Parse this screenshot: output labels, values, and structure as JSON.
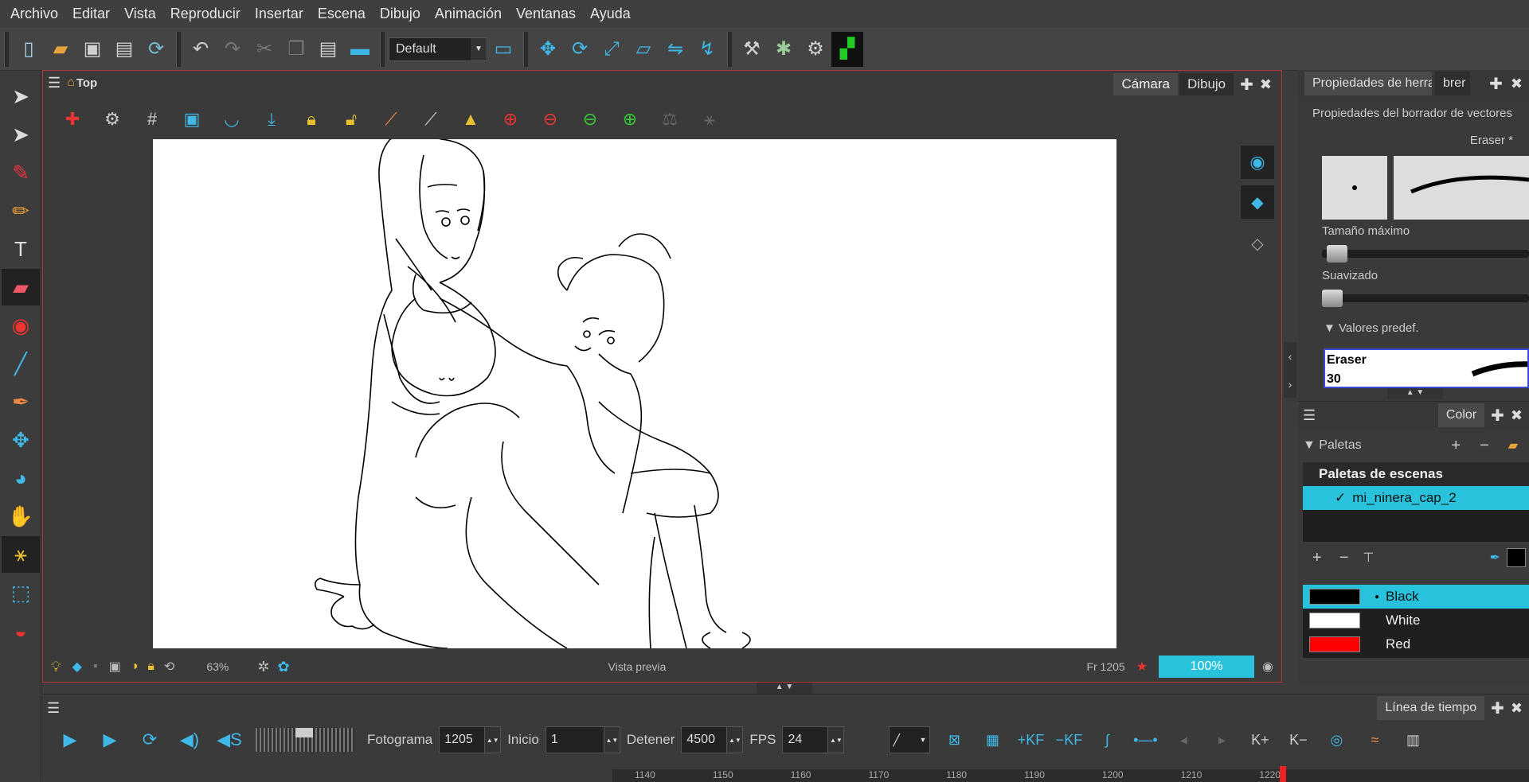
{
  "menu": [
    "Archivo",
    "Editar",
    "Vista",
    "Reproducir",
    "Insertar",
    "Escena",
    "Dibujo",
    "Animación",
    "Ventanas",
    "Ayuda"
  ],
  "toolbar": {
    "workspace": "Default"
  },
  "view": {
    "breadcrumb": "Top",
    "tabs": [
      "Cámara",
      "Dibujo"
    ],
    "zoom": "63%",
    "preview_label": "Vista previa",
    "frame": "Fr 1205",
    "percent": "100%",
    "colors": {
      "accent": "#29c2dc",
      "frame_border": "#b53535"
    }
  },
  "tool_properties": {
    "tabs": [
      "Propiedades de herra..",
      "brer"
    ],
    "heading": "Propiedades del borrador de vectores",
    "preset_name": "Eraser *",
    "max_size_label": "Tamaño máximo",
    "smoothing_label": "Suavizado",
    "presets_label": "Valores predef.",
    "preset_card_title": "Eraser",
    "preset_card_size": "30"
  },
  "color_panel": {
    "tab": "Color",
    "palettes_label": "Paletas",
    "scene_palettes": "Paletas de escenas",
    "palette_name": "mi_ninera_cap_2",
    "swatches": [
      {
        "name": "Black",
        "color": "#000000"
      },
      {
        "name": "White",
        "color": "#ffffff"
      },
      {
        "name": "Red",
        "color": "#ff0000"
      }
    ]
  },
  "timeline": {
    "tab": "Línea de tiempo",
    "frame_label": "Fotograma",
    "frame_value": "1205",
    "start_label": "Inicio",
    "start_value": "1",
    "stop_label": "Detener",
    "stop_value": "4500",
    "fps_label": "FPS",
    "fps_value": "24",
    "kf_label": "KF",
    "ruler": [
      "1140",
      "1150",
      "1160",
      "1170",
      "1180",
      "1190",
      "1200",
      "1210",
      "1220"
    ]
  }
}
